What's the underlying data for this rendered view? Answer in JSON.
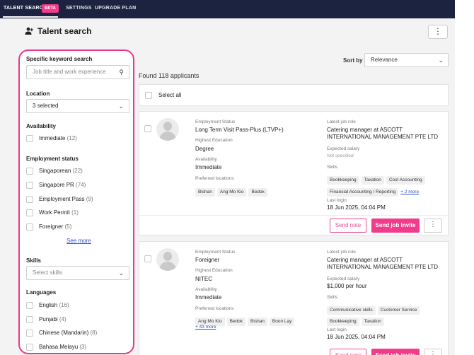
{
  "nav": {
    "tabs": [
      {
        "label": "TALENT SEARCH",
        "badge": "BETA",
        "active": true
      },
      {
        "label": "SETTINGS"
      },
      {
        "label": "UPGRADE PLAN"
      }
    ]
  },
  "page": {
    "title": "Talent search",
    "title_icon": "add-user-icon",
    "menu_icon": "kebab-icon"
  },
  "colors": {
    "accent": "#f23b8a",
    "nav_bg": "#1c2340",
    "link": "#2b4fc7",
    "highlight_border": "#e8388a"
  },
  "filters": {
    "keyword": {
      "label": "Specific keyword search",
      "placeholder": "Job title and work experience"
    },
    "location": {
      "label": "Location",
      "value": "3 selected"
    },
    "availability": {
      "label": "Availability",
      "options": [
        {
          "label": "Immediate",
          "count": "(12)"
        }
      ]
    },
    "employment_status": {
      "label": "Employment status",
      "options": [
        {
          "label": "Singaporean",
          "count": "(22)"
        },
        {
          "label": "Singapore PR",
          "count": "(74)"
        },
        {
          "label": "Employment Pass",
          "count": "(9)"
        },
        {
          "label": "Work Permit",
          "count": "(1)"
        },
        {
          "label": "Foreigner",
          "count": "(5)"
        }
      ],
      "see_more": "See more"
    },
    "skills": {
      "label": "Skills",
      "placeholder": "Select skills"
    },
    "languages": {
      "label": "Languages",
      "options": [
        {
          "label": "English",
          "count": "(16)"
        },
        {
          "label": "Punjabi",
          "count": "(4)"
        },
        {
          "label": "Chinese (Mandarin)",
          "count": "(8)"
        },
        {
          "label": "Bahasa Melayu",
          "count": "(3)"
        }
      ]
    }
  },
  "results": {
    "sort_label": "Sort by",
    "sort_value": "Relevance",
    "found": "Found 118 applicants",
    "select_all": "Select all",
    "labels": {
      "employment_status": "Employment Status",
      "highest_education": "Highest Education",
      "availability": "Availability",
      "preferred_locations": "Preferred locations",
      "latest_job_role": "Latest job role",
      "expected_salary": "Expected salary",
      "skills": "Skills",
      "last_login": "Last login",
      "send_note": "Send note",
      "send_job_invite": "Send job invite"
    },
    "applicants": [
      {
        "employment_status": "Long Term Visit Pass-Plus (LTVP+)",
        "education": "Degree",
        "availability": "Immediate",
        "locations": [
          "Bishan",
          "Ang Mo Kio",
          "Bedok"
        ],
        "locations_more": "",
        "job_role_line1": "Catering manager at ASCOTT",
        "job_role_line2": "INTERNATIONAL MANAGEMENT PTE LTD",
        "salary": "Not specified",
        "skills_row1": [
          "Bookkeeping",
          "Taxation",
          "Cost Accounting"
        ],
        "skills_row2": [
          "Financial Accounting / Reporting"
        ],
        "skills_more": "+ 2 more",
        "last_login": "18 Jun 2025, 04:04 PM"
      },
      {
        "employment_status": "Foreigner",
        "education": "NITEC",
        "availability": "Immediate",
        "locations": [
          "Ang Mo Kio",
          "Bedok",
          "Bishan",
          "Boon Lay"
        ],
        "locations_more": "+ 43 more",
        "job_role_line1": "Catering manager at ASCOTT",
        "job_role_line2": "INTERNATIONAL MANAGEMENT PTE LTD",
        "salary": "$1,000 per hour",
        "skills_row1": [
          "Communicative skills",
          "Customer Service"
        ],
        "skills_row2": [
          "Bookkeeping",
          "Taxation"
        ],
        "skills_more": "",
        "last_login": "18 Jun 2025, 04:04 PM"
      }
    ]
  }
}
